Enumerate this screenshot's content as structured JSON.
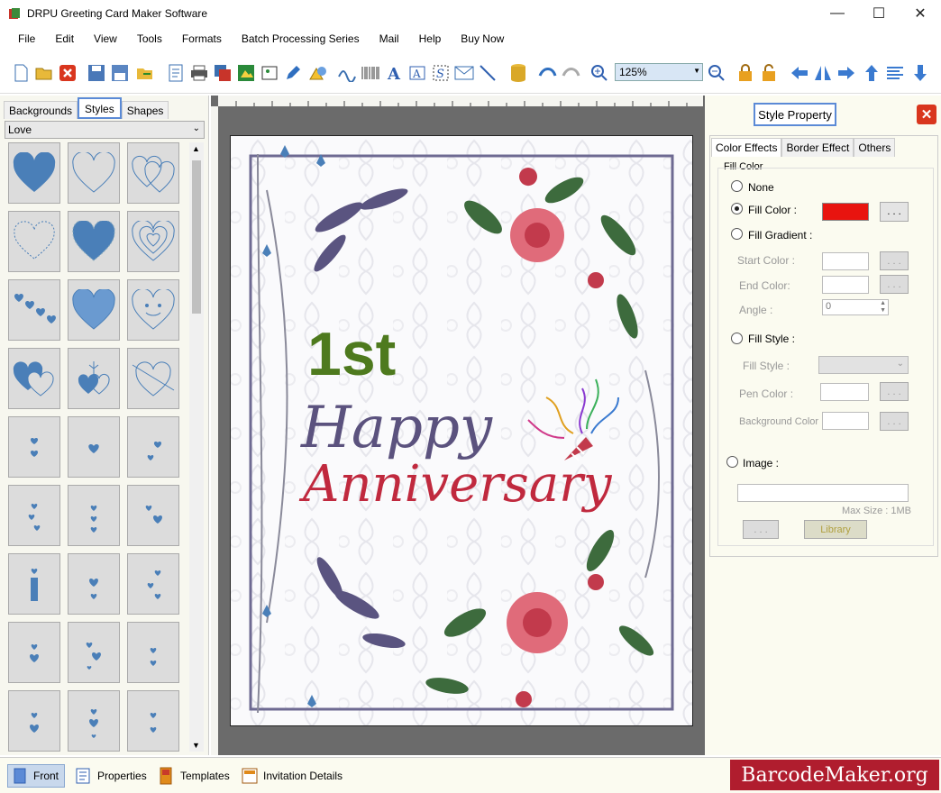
{
  "window": {
    "title": "DRPU Greeting Card Maker Software"
  },
  "menu": [
    "File",
    "Edit",
    "View",
    "Tools",
    "Formats",
    "Batch Processing Series",
    "Mail",
    "Help",
    "Buy Now"
  ],
  "toolbar": {
    "zoom": "125%"
  },
  "left_panel": {
    "tabs": [
      "Backgrounds",
      "Styles",
      "Shapes"
    ],
    "active_tab": "Styles",
    "category": "Love"
  },
  "card": {
    "line1": "1st",
    "line2": "Happy",
    "line3": "Anniversary"
  },
  "style_property": {
    "title": "Style Property",
    "tabs": [
      "Color Effects",
      "Border Effect",
      "Others"
    ],
    "group": "Fill Color",
    "none": "None",
    "fill_color": "Fill Color :",
    "fill_color_value": "#e8140f",
    "fill_gradient": "Fill Gradient :",
    "start_color": "Start Color :",
    "end_color": "End Color:",
    "angle": "Angle :",
    "angle_value": "0",
    "fill_style_radio": "Fill Style :",
    "fill_style": "Fill Style :",
    "pen_color": "Pen Color :",
    "background_color": "Background Color :",
    "image": "Image :",
    "max_size": "Max Size : 1MB",
    "browse": ". . .",
    "library": "Library"
  },
  "status_bar": {
    "front": "Front",
    "properties": "Properties",
    "templates": "Templates",
    "invitation": "Invitation Details",
    "brand": "BarcodeMaker.org"
  }
}
